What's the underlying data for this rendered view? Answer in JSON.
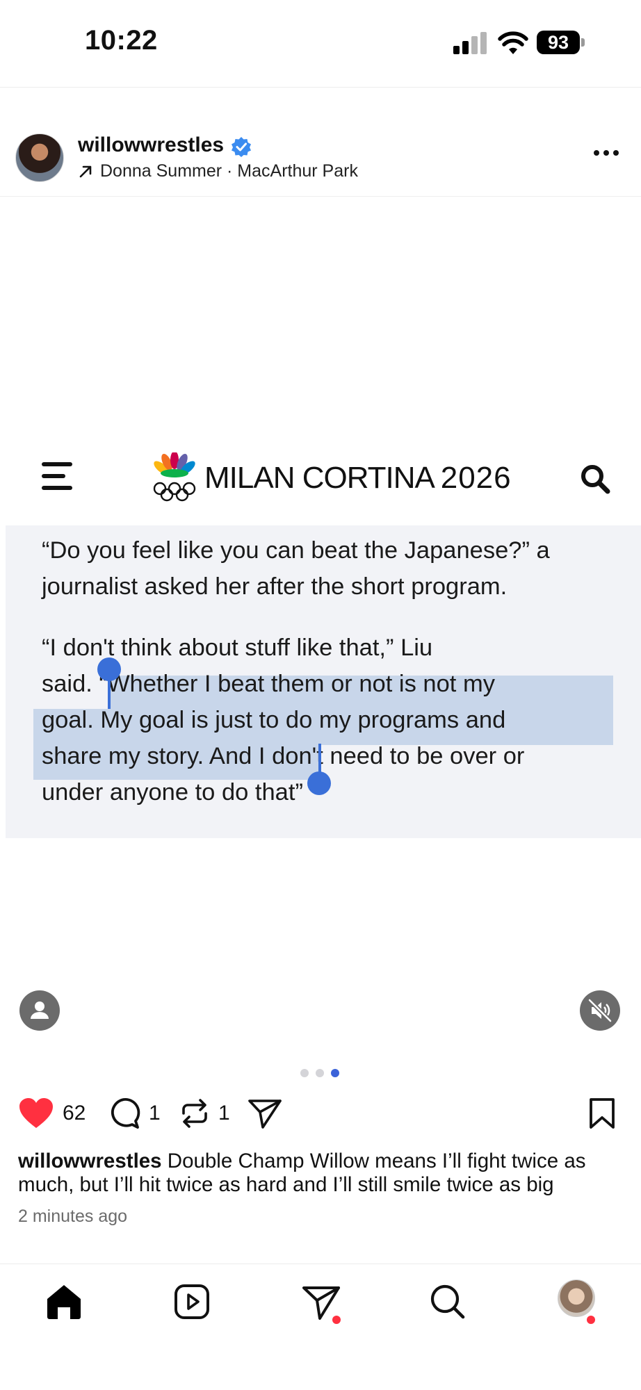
{
  "status_bar": {
    "time": "10:22",
    "battery": "93"
  },
  "post": {
    "username": "willowwrestles",
    "music": "Donna Summer · MacArthur Park",
    "media": {
      "brand": "MILAN CORTINA",
      "brand_year": "2026",
      "paragraph_1": [
        "“Do you feel like you can beat the Japanese?” a",
        "journalist asked her after the short program."
      ],
      "paragraph_2": [
        "“I don't think about stuff like that,” Liu",
        "said. “Whether I beat them or not is not my",
        "goal.  My goal is just to do my programs and",
        "share my story. And I don't need to be over or",
        "under anyone to do that”"
      ],
      "carousel": {
        "count": 3,
        "active_index": 2
      }
    },
    "likes": "62",
    "comments": "1",
    "reposts": "1",
    "caption": "Double Champ Willow means I’ll fight twice as much, but I’ll hit twice as hard and I’ll still smile twice as big",
    "time_ago": "2 minutes ago"
  },
  "colors": {
    "accent": "#3a6fd8",
    "like": "#ff3040",
    "selection": "#c8d6ea"
  },
  "tab_bar": {
    "items": [
      "home-icon",
      "reels-icon",
      "direct-icon",
      "search-icon",
      "profile-avatar"
    ]
  }
}
